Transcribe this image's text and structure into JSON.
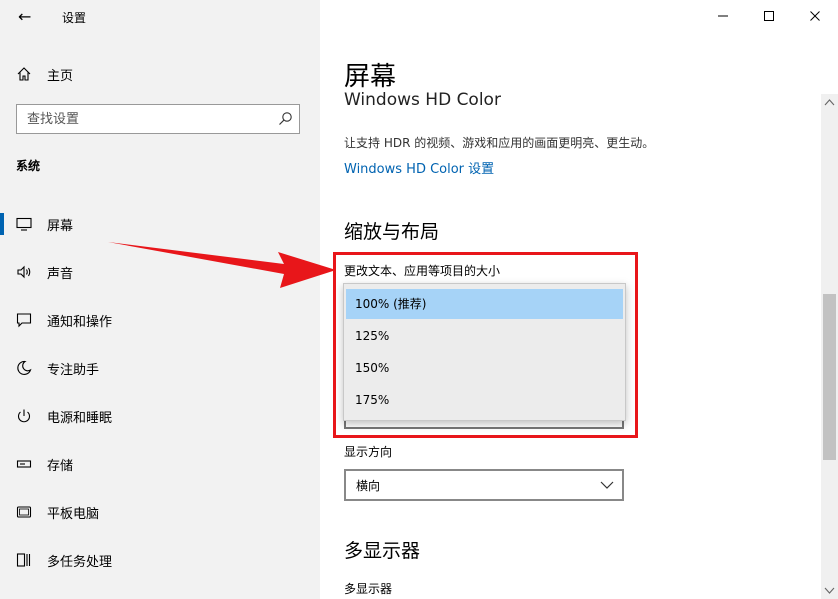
{
  "app": {
    "title": "设置"
  },
  "sidebar": {
    "home_label": "主页",
    "search_placeholder": "查找设置",
    "section_label": "系统",
    "items": [
      {
        "label": "屏幕",
        "icon": "monitor-icon",
        "active": true
      },
      {
        "label": "声音",
        "icon": "speaker-icon"
      },
      {
        "label": "通知和操作",
        "icon": "notification-icon"
      },
      {
        "label": "专注助手",
        "icon": "moon-icon"
      },
      {
        "label": "电源和睡眠",
        "icon": "power-icon"
      },
      {
        "label": "存储",
        "icon": "storage-icon"
      },
      {
        "label": "平板电脑",
        "icon": "tablet-icon"
      },
      {
        "label": "多任务处理",
        "icon": "multitask-icon"
      }
    ]
  },
  "main": {
    "page_title": "屏幕",
    "hd_heading": "Windows HD Color",
    "hd_description": "让支持 HDR 的视频、游戏和应用的画面更明亮、更生动。",
    "hd_link": "Windows HD Color 设置",
    "scale_heading": "缩放与布局",
    "scale_label": "更改文本、应用等项目的大小",
    "scale_options": [
      "100% (推荐)",
      "125%",
      "150%",
      "175%"
    ],
    "scale_selected_index": 0,
    "orientation_label": "显示方向",
    "orientation_value": "横向",
    "multi_heading": "多显示器",
    "multi_label": "多显示器"
  },
  "colors": {
    "accent": "#0063b1",
    "highlight_red": "#e8161a",
    "selected_option": "#a6d3f7"
  }
}
